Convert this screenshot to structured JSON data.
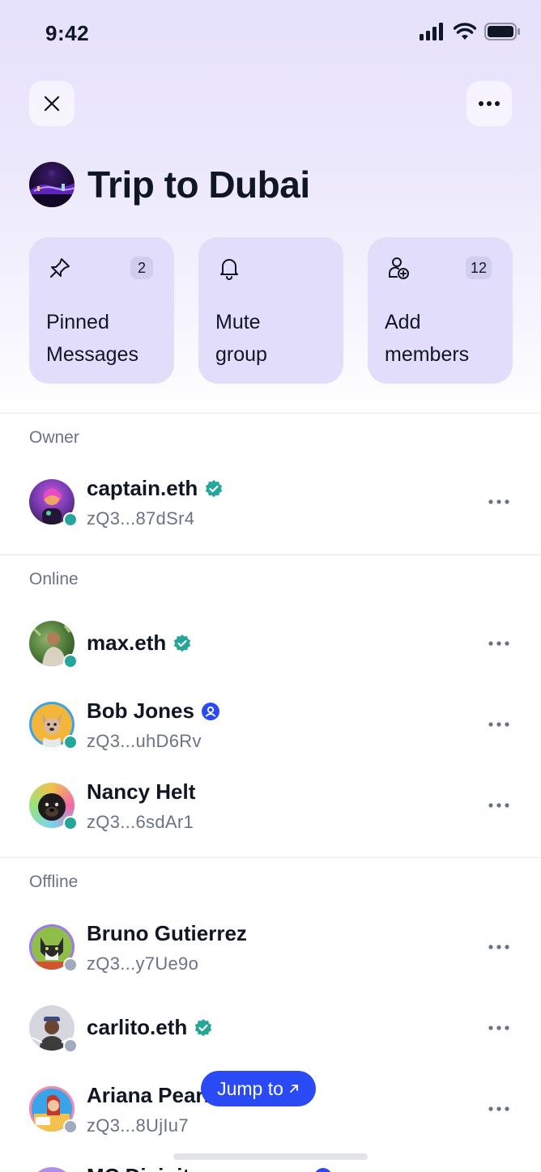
{
  "status_bar": {
    "time": "9:42"
  },
  "header": {
    "title": "Trip to Dubai",
    "close_icon": "close-icon",
    "more_icon": "more-horizontal-icon"
  },
  "actions": [
    {
      "icon": "pin-icon",
      "label": "Pinned\nMessages",
      "badge": "2"
    },
    {
      "icon": "bell-icon",
      "label": "Mute\ngroup",
      "badge": ""
    },
    {
      "icon": "add-member-icon",
      "label": "Add\nmembers",
      "badge": "12"
    }
  ],
  "sections": {
    "owner": "Owner",
    "online": "Online",
    "offline": "Offline"
  },
  "members": {
    "owner": [
      {
        "name": "captain.eth",
        "key": "zQ3...87dSr4",
        "badge": "verified",
        "status": "online"
      }
    ],
    "online": [
      {
        "name": "max.eth",
        "key": "",
        "badge": "verified",
        "status": "online"
      },
      {
        "name": "Bob Jones",
        "key": "zQ3...uhD6Rv",
        "badge": "contact",
        "status": "online"
      },
      {
        "name": "Nancy Helt",
        "key": "zQ3...6sdAr1",
        "badge": "",
        "status": "online"
      }
    ],
    "offline": [
      {
        "name": "Bruno Gutierrez",
        "key": "zQ3...y7Ue9o",
        "badge": "",
        "status": "offline"
      },
      {
        "name": "carlito.eth",
        "key": "",
        "badge": "verified",
        "status": "offline"
      },
      {
        "name": "Ariana Pearl",
        "key": "zQ3...8UjIu7",
        "badge": "",
        "status": "offline"
      },
      {
        "name": "MC Divinity",
        "key": "",
        "badge": "contact",
        "status": "offline"
      }
    ]
  },
  "jump_to": {
    "label": "Jump to",
    "icon": "arrow-up-right-icon"
  },
  "colors": {
    "online": "#26a69a",
    "offline": "#a1abbd",
    "verified": "#26a69a",
    "contact": "#2a4af5",
    "accent": "#2a4af5",
    "card": "#e2ddfa"
  }
}
